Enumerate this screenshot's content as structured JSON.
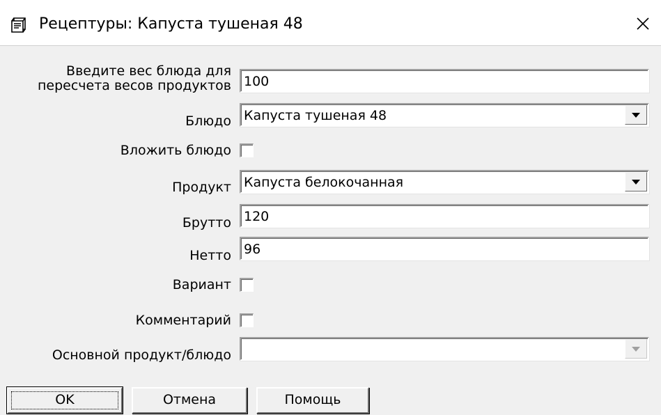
{
  "window": {
    "title": "Рецептуры: Капуста тушеная 48"
  },
  "form": {
    "weight": {
      "label": "Введите вес блюда для пересчета весов продуктов",
      "value": "100"
    },
    "dish": {
      "label": "Блюдо",
      "value": "Капуста тушеная 48"
    },
    "nest_dish": {
      "label": "Вложить блюдо",
      "checked": false
    },
    "product": {
      "label": "Продукт",
      "value": "Капуста белокочанная"
    },
    "gross": {
      "label": "Брутто",
      "value": "120"
    },
    "net": {
      "label": "Нетто",
      "value": "96"
    },
    "variant": {
      "label": "Вариант",
      "checked": false
    },
    "comment": {
      "label": "Комментарий",
      "checked": false
    },
    "main_product": {
      "label": "Основной продукт/блюдо",
      "value": "",
      "enabled": false
    }
  },
  "buttons": {
    "ok": "OK",
    "cancel": "Отмена",
    "help": "Помощь"
  },
  "icons": {
    "title": "dictionary-icon",
    "close": "close-icon",
    "dropdown": "chevron-down-icon"
  },
  "colors": {
    "titlebar_bg": "#ffffff",
    "dialog_bg": "#f0f0f0",
    "field_bg": "#ffffff",
    "disabled_arrow": "#a0a0a0"
  }
}
